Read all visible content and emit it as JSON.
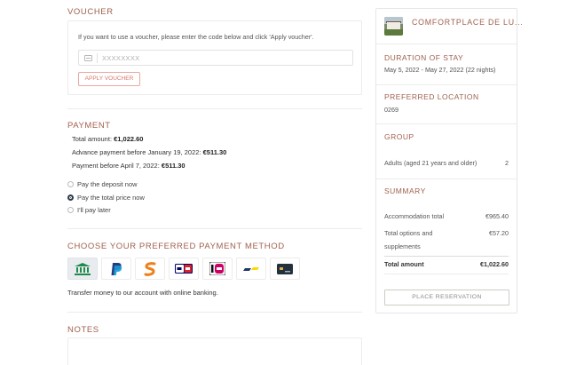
{
  "voucher": {
    "title": "VOUCHER",
    "instructions": "If you want to use a voucher, please enter the code below and click 'Apply voucher'.",
    "placeholder": "XXXXXXXX",
    "apply_label": "APPLY VOUCHER"
  },
  "payment": {
    "title": "PAYMENT",
    "total_label": "Total amount: ",
    "total_value": "€1,022.60",
    "advance_label": "Advance payment before January 19, 2022: ",
    "advance_value": "€511.30",
    "before_label": "Payment before April 7, 2022: ",
    "before_value": "€511.30",
    "options": [
      {
        "label": "Pay the deposit now",
        "selected": false
      },
      {
        "label": "Pay the total price now",
        "selected": true
      },
      {
        "label": "I'll pay later",
        "selected": false
      }
    ]
  },
  "methods": {
    "title": "CHOOSE YOUR PREFERRED PAYMENT METHOD",
    "items": [
      "bank-transfer-icon",
      "paypal-icon",
      "sofort-icon",
      "giropay-icon",
      "ideal-icon",
      "bancontact-icon",
      "credit-card-icon"
    ],
    "description": "Transfer money to our account with online banking."
  },
  "notes": {
    "title": "NOTES"
  },
  "summary_panel": {
    "property_name": "COMFORTPLACE DE LU...",
    "duration_label": "DURATION OF STAY",
    "duration_value": "May 5, 2022 - May 27, 2022 (22 nights)",
    "location_label": "PREFERRED LOCATION",
    "location_value": "0269",
    "group_label": "GROUP",
    "group_desc": "Adults (aged 21 years and older)",
    "group_count": "2",
    "summary_label": "SUMMARY",
    "accommodation_label": "Accommodation total",
    "accommodation_value": "€965.40",
    "options_label_1": "Total options and",
    "options_label_2": "supplements",
    "options_value": "€57.20",
    "total_label": "Total amount",
    "total_value": "€1,022.60",
    "place_label": "PLACE RESERVATION"
  },
  "colors": {
    "accent": "#a0614e",
    "button_border": "#e8a9a0"
  }
}
